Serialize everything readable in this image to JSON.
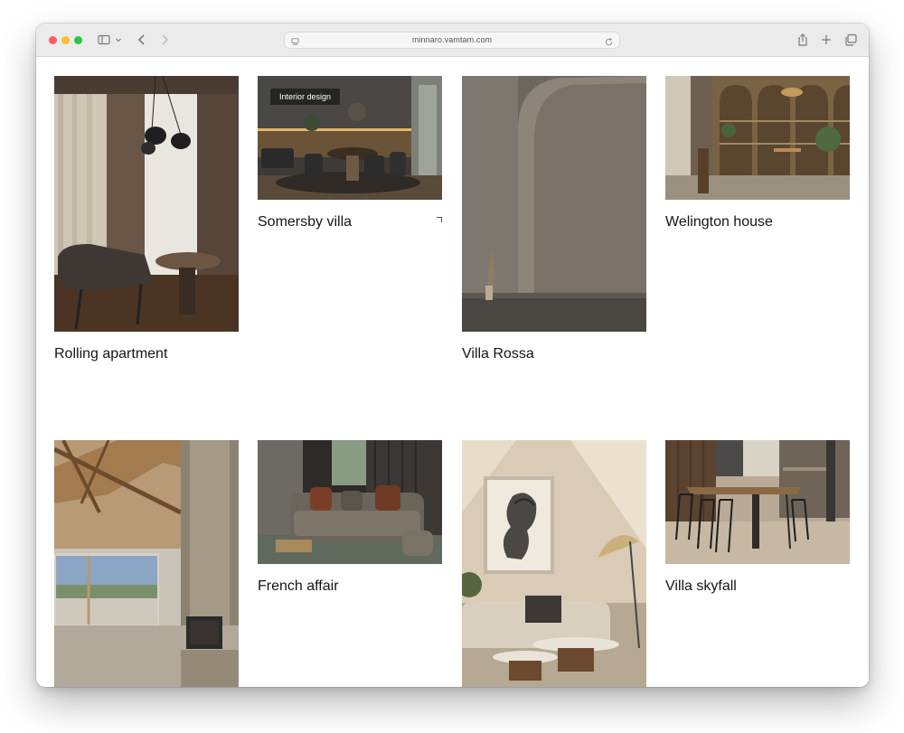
{
  "browser": {
    "url": "minnaro.vamtam.com"
  },
  "portfolio": {
    "items": [
      {
        "title": "Rolling apartment"
      },
      {
        "title": "Somersby villa",
        "badge": "Interior design"
      },
      {
        "title": "Villa Rossa"
      },
      {
        "title": "Welington house"
      },
      {
        "title": ""
      },
      {
        "title": "French affair"
      },
      {
        "title": ""
      },
      {
        "title": "Villa skyfall"
      }
    ]
  }
}
